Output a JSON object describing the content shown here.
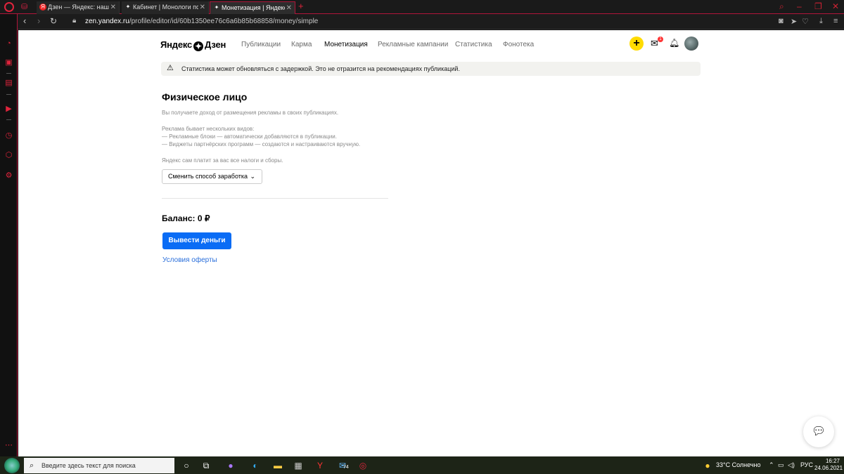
{
  "browser": {
    "tabs": [
      {
        "label": "Дзен — Яндекс: нашлось",
        "icon": "yandex-icon"
      },
      {
        "label": "Кабинет | Монологи псих",
        "icon": "zen-icon"
      },
      {
        "label": "Монетизация | Яндекс Дз",
        "icon": "zen-icon",
        "active": true
      }
    ],
    "url_host": "zen.yandex.ru",
    "url_path": "/profile/editor/id/60b1350ee76c6a6b85b68858/money/simple"
  },
  "header": {
    "logo_left": "Яндекс",
    "logo_right": "Дзен",
    "menu": [
      {
        "label": "Публикации"
      },
      {
        "label": "Карма"
      },
      {
        "label": "Монетизация",
        "active": true
      },
      {
        "label": "Рекламные кампании"
      },
      {
        "label": "Статистика"
      },
      {
        "label": "Фонотека"
      }
    ],
    "notification_count": "1"
  },
  "warning": {
    "text": "Статистика может обновляться с задержкой. Это не отразится на рекомендациях публикаций."
  },
  "main": {
    "title": "Физическое лицо",
    "intro": "Вы получаете доход от размещения рекламы в своих публикациях.",
    "ads_heading": "Реклама бывает нескольких видов:",
    "ads_item_1": "— Рекламные блоки — автоматически добавляются в публикации.",
    "ads_item_2": "— Виджеты партнёрских программ — создаются и настраиваются вручную.",
    "taxes": "Яндекс сам платит за вас все налоги и сборы.",
    "change_method": "Сменить способ заработка",
    "balance": "Баланс: 0 ₽",
    "withdraw": "Вывести деньги",
    "offer_link": "Условия оферты"
  },
  "taskbar": {
    "search_placeholder": "Введите здесь текст для поиска",
    "mail_badge": "74",
    "weather": "33°C  Солнечно",
    "language": "РУС",
    "time": "16:27",
    "date": "24.06.2021"
  },
  "colors": {
    "accent_blue": "#0a6cf5",
    "plus_yellow": "#ffdb00",
    "opera_red": "#e0243c"
  }
}
